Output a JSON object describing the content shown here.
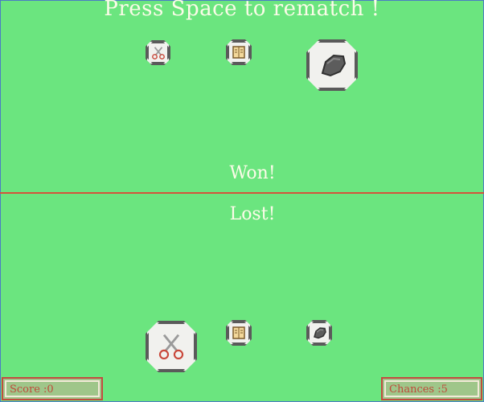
{
  "game": {
    "prompt": "Press Space to rematch !",
    "opponent_result": "Won!",
    "player_result": "Lost!",
    "score_label": "Score :0",
    "chances_label": "Chances :5"
  },
  "opponent": {
    "choices": [
      {
        "icon": "scissors-icon",
        "selected": false
      },
      {
        "icon": "paper-icon",
        "selected": false
      },
      {
        "icon": "rock-icon",
        "selected": true
      }
    ]
  },
  "player": {
    "choices": [
      {
        "icon": "scissors-icon",
        "selected": true
      },
      {
        "icon": "paper-icon",
        "selected": false
      },
      {
        "icon": "rock-icon",
        "selected": false
      }
    ]
  },
  "colors": {
    "background": "#6be57f",
    "divider": "#d4533b",
    "text": "#fbfbe8",
    "hud_border": "#c24c3f",
    "hud_fill": "#9fc68a"
  }
}
